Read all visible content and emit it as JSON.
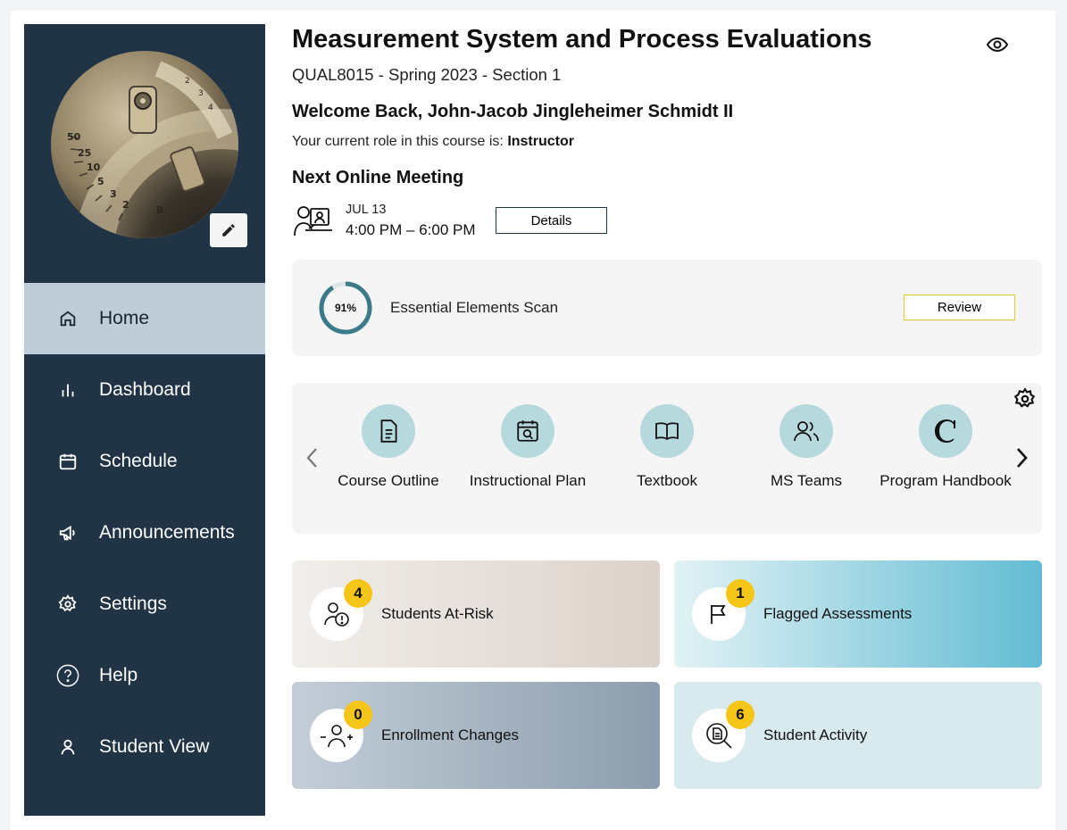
{
  "sidebar": {
    "items": [
      {
        "label": "Home",
        "icon": "home-icon",
        "active": true
      },
      {
        "label": "Dashboard",
        "icon": "bar-chart-icon"
      },
      {
        "label": "Schedule",
        "icon": "calendar-icon"
      },
      {
        "label": "Announcements",
        "icon": "megaphone-icon"
      },
      {
        "label": "Settings",
        "icon": "gear-icon"
      },
      {
        "label": "Help",
        "icon": "help-circle-icon"
      },
      {
        "label": "Student View",
        "icon": "user-icon"
      }
    ]
  },
  "header": {
    "title": "Measurement System and Process Evaluations",
    "course_code": "QUAL8015 - Spring 2023 - Section 1",
    "welcome": "Welcome Back, John-Jacob Jingleheimer Schmidt II",
    "role_prefix": "Your current role in this course is:",
    "role": "Instructor"
  },
  "meeting": {
    "heading": "Next Online Meeting",
    "date": "JUL 13",
    "time": "4:00 PM – 6:00 PM",
    "details_label": "Details"
  },
  "scan": {
    "percent_label": "91%",
    "percent": 91,
    "label": "Essential Elements Scan",
    "review_label": "Review"
  },
  "links": [
    {
      "label": "Course Outline",
      "icon": "document-icon"
    },
    {
      "label": "Instructional Plan",
      "icon": "calendar-search-icon"
    },
    {
      "label": "Textbook",
      "icon": "book-icon"
    },
    {
      "label": "MS Teams",
      "icon": "users-icon"
    },
    {
      "label": "Program Handbook",
      "icon": "c-logo-icon"
    }
  ],
  "tiles": [
    {
      "label": "Students At-Risk",
      "count": "4",
      "icon": "user-alert-icon"
    },
    {
      "label": "Flagged Assessments",
      "count": "1",
      "icon": "flag-icon"
    },
    {
      "label": "Enrollment Changes",
      "count": "0",
      "icon": "user-plus-minus-icon"
    },
    {
      "label": "Student Activity",
      "count": "6",
      "icon": "document-search-icon"
    }
  ],
  "colors": {
    "sidebar_bg": "#203446",
    "active_nav_bg": "#bfcdd9",
    "link_circle": "#b5d9dd",
    "ring": "#3b7a88",
    "badge": "#f5c518"
  }
}
